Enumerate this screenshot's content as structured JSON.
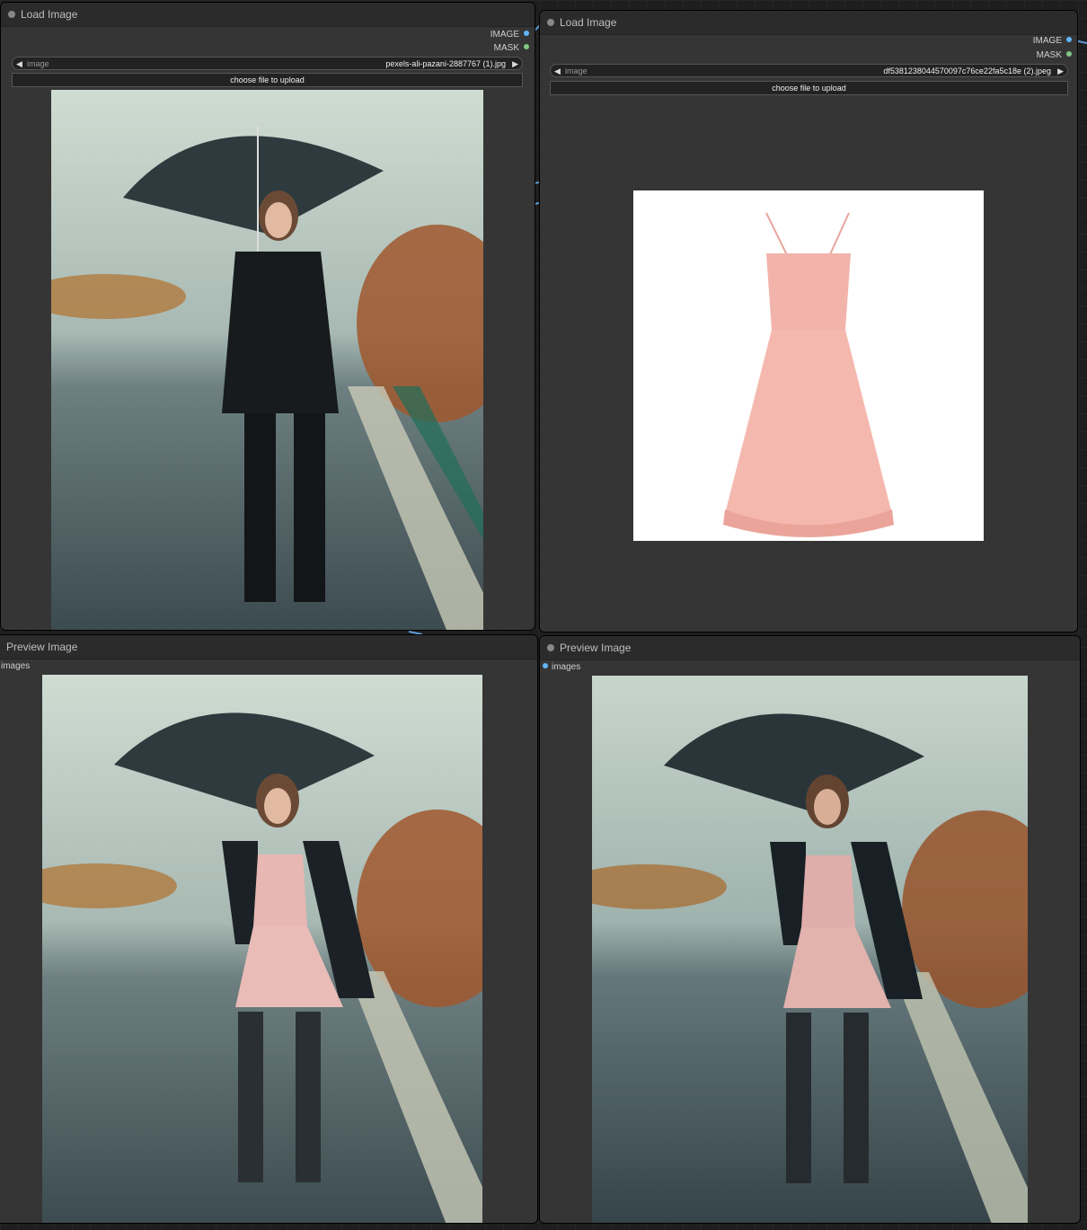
{
  "nodes": {
    "load1": {
      "title": "Load Image",
      "outputs": [
        "IMAGE",
        "MASK"
      ],
      "widget_label": "image",
      "widget_value": "pexels-ali-pazani-2887767 (1).jpg",
      "upload_label": "choose file to upload"
    },
    "load2": {
      "title": "Load Image",
      "outputs": [
        "IMAGE",
        "MASK"
      ],
      "widget_label": "image",
      "widget_value": "df5381238044570097c76ce22fa5c18e (2).jpeg",
      "upload_label": "choose file to upload"
    },
    "preview1": {
      "title": "Preview Image",
      "input": "images"
    },
    "preview2": {
      "title": "Preview Image",
      "input": "images"
    }
  },
  "icons": {
    "prev": "◀",
    "next": "▶"
  },
  "colors": {
    "image_socket": "#64b5f6",
    "mask_socket": "#81c784",
    "node_bg": "#353535",
    "title_bg": "#2b2b2b"
  }
}
